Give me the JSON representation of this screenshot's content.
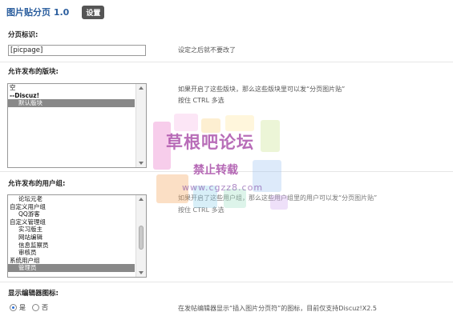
{
  "header": {
    "title": "图片贴分页 1.0",
    "setting_button": "设置"
  },
  "picpage_id": {
    "label": "分页标识:",
    "value": "[picpage]",
    "hint": "设定之后就不要改了"
  },
  "allowed_forums": {
    "label": "允许发布的版块:",
    "items": [
      {
        "text": "空",
        "indent": false,
        "bold": false,
        "selected": false
      },
      {
        "text": "--Discuz!",
        "indent": false,
        "bold": true,
        "selected": false
      },
      {
        "text": "默认版块",
        "indent": true,
        "bold": false,
        "selected": true
      }
    ],
    "hint_line1": "如果开启了这些版块，那么这些版块里可以发“分页图片贴”",
    "hint_line2": "按住 CTRL 多选"
  },
  "allowed_groups": {
    "label": "允许发布的用户组:",
    "items": [
      {
        "text": "论坛元老",
        "indent": true,
        "bold": false,
        "selected": false
      },
      {
        "text": "自定义用户组",
        "indent": false,
        "bold": false,
        "selected": false
      },
      {
        "text": "QQ游客",
        "indent": true,
        "bold": false,
        "selected": false
      },
      {
        "text": "自定义管理组",
        "indent": false,
        "bold": false,
        "selected": false
      },
      {
        "text": "实习版主",
        "indent": true,
        "bold": false,
        "selected": false
      },
      {
        "text": "网站编辑",
        "indent": true,
        "bold": false,
        "selected": false
      },
      {
        "text": "信息监察员",
        "indent": true,
        "bold": false,
        "selected": false
      },
      {
        "text": "审核员",
        "indent": true,
        "bold": false,
        "selected": false
      },
      {
        "text": "系统用户组",
        "indent": false,
        "bold": false,
        "selected": false
      },
      {
        "text": "管理员",
        "indent": true,
        "bold": false,
        "selected": true
      }
    ],
    "hint_line1": "如果开启了这些用户组，那么这些用户组里的用户可以发“分页图片贴”",
    "hint_line2": "按住 CTRL 多选"
  },
  "editor_icon": {
    "label": "显示编辑器图标:",
    "options": [
      "是",
      "否"
    ],
    "selected": "是",
    "hint": "在发帖编辑器显示“插入图片分页符”的图标，目前仅支持Discuz!X2.5"
  },
  "watermark": {
    "title": "草根吧论坛",
    "subtitle": "禁止转载",
    "url": "www.cgzz8.com"
  },
  "colors": {
    "title_blue": "#2b5e9e",
    "selected_row": "#888888",
    "setting_button_bg": "#555555"
  }
}
